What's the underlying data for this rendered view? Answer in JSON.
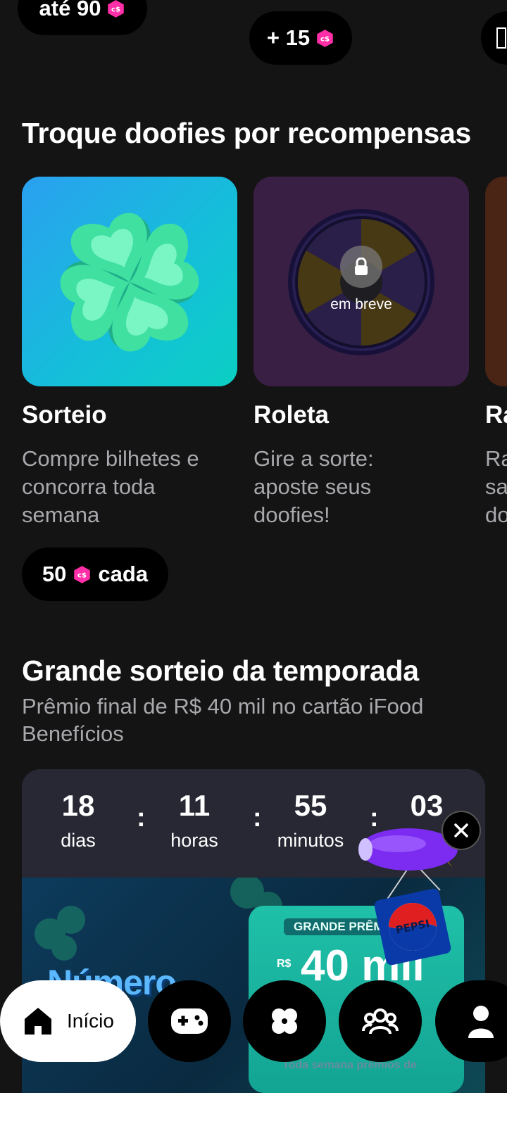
{
  "top_chips": [
    {
      "text": "até 90"
    },
    {
      "text": "+ 15"
    }
  ],
  "rewards": {
    "title": "Troque doofies por recompensas",
    "cards": [
      {
        "title": "Sorteio",
        "desc": "Compre bilhetes e concorra toda semana",
        "badge": ""
      },
      {
        "title": "Roleta",
        "desc": "Gire a sorte: aposte seus doofies!",
        "badge": "em breve"
      },
      {
        "title": "Ra",
        "desc": "Ra sa do",
        "badge": ""
      }
    ],
    "price_number": "50",
    "price_suffix": "cada"
  },
  "season": {
    "title": "Grande sorteio da temporada",
    "subtitle": "Prêmio final de R$ 40 mil no cartão iFood Benefícios",
    "countdown": [
      {
        "value": "18",
        "label": "dias"
      },
      {
        "value": "11",
        "label": "horas"
      },
      {
        "value": "55",
        "label": "minutos"
      },
      {
        "value": "03",
        "label": ""
      }
    ],
    "separator": ":"
  },
  "banner": {
    "numero": "Número",
    "premio_label": "GRANDE PRÊM",
    "currency": "R$",
    "amount": "40 mil",
    "footer": "Toda semana prêmios de",
    "brand": "PEPSI"
  },
  "nav": {
    "home_label": "Início",
    "items": [
      "games",
      "clover",
      "community",
      "profile"
    ]
  },
  "colors": {
    "background": "#141415",
    "card_sorteio": "#1fb4e6",
    "card_roleta": "#3a1f44",
    "chip_bg": "#000000",
    "coin": "#ff2fa8",
    "blimp": "#7b2cf0"
  }
}
